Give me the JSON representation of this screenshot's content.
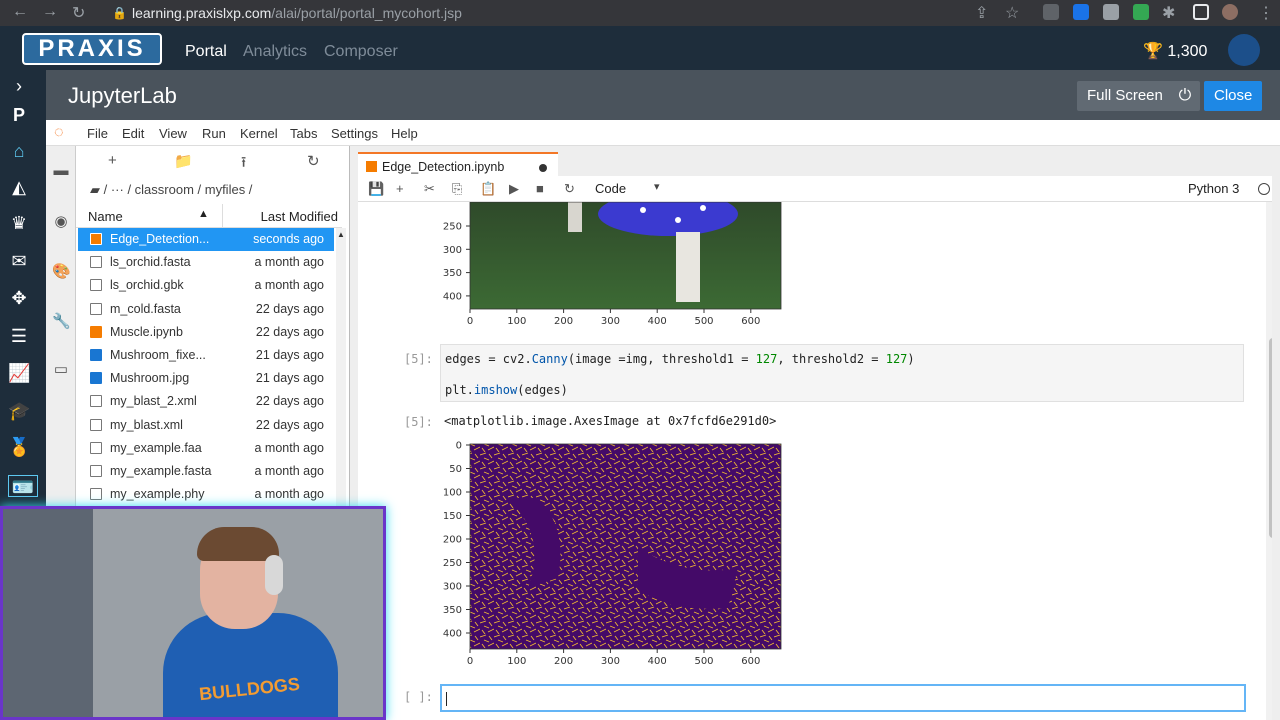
{
  "browser": {
    "url_host": "learning.praxislxp.com",
    "url_path": "/alai/portal/portal_mycohort.jsp"
  },
  "praxis": {
    "logo": "PRAXIS",
    "nav": [
      "Portal",
      "Analytics",
      "Composer"
    ],
    "active_nav": "Portal",
    "points": "1,300"
  },
  "jupyter": {
    "title": "JupyterLab",
    "fullscreen_label": "Full Screen",
    "close_label": "Close",
    "menu": [
      "File",
      "Edit",
      "View",
      "Run",
      "Kernel",
      "Tabs",
      "Settings",
      "Help"
    ]
  },
  "filebrowser": {
    "breadcrumb": "/ ··· / classroom / myfiles /",
    "col_name": "Name",
    "col_modified": "Last Modified",
    "files": [
      {
        "name": "Edge_Detection...",
        "modified": "seconds ago",
        "type": "notebook",
        "selected": true
      },
      {
        "name": "ls_orchid.fasta",
        "modified": "a month ago",
        "type": "file"
      },
      {
        "name": "ls_orchid.gbk",
        "modified": "a month ago",
        "type": "file"
      },
      {
        "name": "m_cold.fasta",
        "modified": "22 days ago",
        "type": "file"
      },
      {
        "name": "Muscle.ipynb",
        "modified": "22 days ago",
        "type": "notebook"
      },
      {
        "name": "Mushroom_fixe...",
        "modified": "21 days ago",
        "type": "image"
      },
      {
        "name": "Mushroom.jpg",
        "modified": "21 days ago",
        "type": "image"
      },
      {
        "name": "my_blast_2.xml",
        "modified": "22 days ago",
        "type": "file"
      },
      {
        "name": "my_blast.xml",
        "modified": "22 days ago",
        "type": "file"
      },
      {
        "name": "my_example.faa",
        "modified": "a month ago",
        "type": "file"
      },
      {
        "name": "my_example.fasta",
        "modified": "a month ago",
        "type": "file"
      },
      {
        "name": "my_example.phy",
        "modified": "a month ago",
        "type": "file"
      }
    ]
  },
  "notebook": {
    "tab_name": "Edge_Detection.ipynb",
    "cell_type": "Code",
    "kernel": "Python 3",
    "prompt_in": "[5]:",
    "prompt_out": "[5]:",
    "prompt_empty": "[ ]:",
    "output_text": "<matplotlib.image.AxesImage at 0x7fcfd6e291d0>",
    "code": {
      "line1_a": "edges = cv2.",
      "line1_fn": "Canny",
      "line1_b": "(image =img, threshold1 = ",
      "line1_n1": "127",
      "line1_c": ", threshold2 = ",
      "line1_n2": "127",
      "line1_d": ")",
      "line2_a": "plt.",
      "line2_fn": "imshow",
      "line2_b": "(edges)"
    },
    "plot1": {
      "x_ticks": [
        "0",
        "100",
        "200",
        "300",
        "400",
        "500",
        "600"
      ],
      "y_ticks": [
        "250",
        "300",
        "350",
        "400"
      ]
    },
    "plot2": {
      "x_ticks": [
        "0",
        "100",
        "200",
        "300",
        "400",
        "500",
        "600"
      ],
      "y_ticks": [
        "0",
        "50",
        "100",
        "150",
        "200",
        "250",
        "300",
        "350",
        "400"
      ]
    }
  },
  "webcam": {
    "shirt_text": "BULLDOGS"
  }
}
